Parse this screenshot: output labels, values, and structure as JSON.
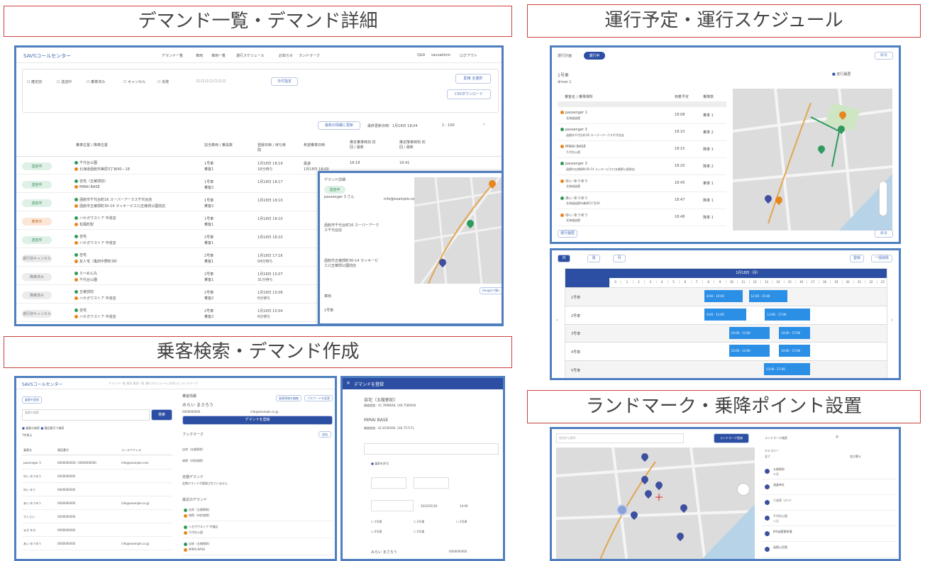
{
  "banners": {
    "demand_list": "デマンド一覧・デマンド詳細",
    "schedule": "運行予定・運行スケジュール",
    "passenger": "乗客検索・デマンド作成",
    "landmark": "ランドマーク・乗降ポイント設置"
  },
  "colors": {
    "panel_border": "#4f7fbf",
    "banner_border": "#c9433f",
    "accent": "#2b8fe6",
    "header_blue": "#2d4fa3"
  },
  "app": {
    "logo": "SAVSコールセンター",
    "nav": [
      "デマンド一覧",
      "車両",
      "車両一覧",
      "運行スケジュール",
      "お知らせ",
      "ランドマーク"
    ],
    "right": [
      "Q&A",
      "savsadmin",
      "ログアウト"
    ]
  },
  "demand_list": {
    "filters": [
      "確定前",
      "送迎中",
      "乗車済み",
      "キャンセル",
      "失敗"
    ],
    "date_button": "日付指定",
    "buttons": [
      "配車 全選択",
      "CSVダウンロード"
    ],
    "refresh": "最新の情報に更新",
    "updated": "最終更新日時：1月18日 18:04",
    "page": "1 - 100",
    "headers": [
      "乗車位置 / 降車位置",
      "割当車両 / 乗員数",
      "登録日時 / 待ち時間",
      "希望乗車日時",
      "推定乗車時刻 初回 / 最新",
      "推定降車時刻 初回 / 最新"
    ],
    "rows": [
      {
        "status": "送迎中",
        "kind": "green",
        "from": "千代台公園",
        "to": "北海道函館市美原3丁目40－18",
        "car": "1号車",
        "staff": "乗客1",
        "reg": "1月18日 18:19",
        "wait": "18分待ち",
        "want": "最速",
        "want2": "1月18日 18:00",
        "est1": "18:18",
        "est2": "18:41"
      },
      {
        "status": "送迎中",
        "kind": "green",
        "from": "自宅（五稜郭前）",
        "to": "MIRAI BASE",
        "car": "1号車",
        "staff": "乗客2",
        "reg": "1月18日 18:17"
      },
      {
        "status": "送迎中",
        "kind": "green",
        "from": "函館市千代台町16 スーパーアークス千代台店",
        "to": "函館市五稜郭町30-14 ラッキーピエロ五稜郭公園前店",
        "car": "1号車",
        "staff": "乗客2",
        "reg": "1月18日 18:10"
      },
      {
        "status": "乗車中",
        "kind": "orange",
        "from": "ハセガワストア 中道店",
        "to": "松風町駅",
        "car": "1号車",
        "staff": "乗客1",
        "reg": "1月18日 18:10"
      },
      {
        "status": "送迎中",
        "kind": "green",
        "from": "自宅",
        "to": "ハセガワストア 中道店",
        "car": "2号車",
        "staff": "乗客1",
        "reg": "1月18日 18:10"
      },
      {
        "status": "運行前キャンセル",
        "kind": "gray",
        "from": "自宅",
        "to": "友人宅（亀田中野町38）",
        "car": "2号車",
        "staff": "乗客1",
        "reg": "1月18日 17:16",
        "wait": "04分待ち"
      },
      {
        "status": "降車済み",
        "kind": "gray",
        "from": "ら～めん丸",
        "to": "千代台公園",
        "car": "2号車",
        "staff": "乗客1",
        "reg": "1月18日 15:07",
        "wait": "31分待ち"
      },
      {
        "status": "降車済み",
        "kind": "gray",
        "from": "五稜郭前",
        "to": "ハセガワストア 中道店",
        "car": "2号車",
        "staff": "乗客2",
        "reg": "1月18日 15:08",
        "wait": "6分待ち"
      },
      {
        "status": "運行前キャンセル",
        "kind": "gray",
        "from": "自宅",
        "to": "ハセガワストア 中道店",
        "car": "2号車",
        "staff": "乗客2",
        "reg": "1月18日 15:04",
        "wait": "6分待ち"
      }
    ],
    "popup": {
      "title": "デマンド詳細",
      "badge": "送迎中",
      "name": "passenger 3 さん",
      "email": "info@example.com",
      "stop1": "函館市千代台町16 スーパーアークス千代台店",
      "stop2": "函館市五稜郭町30-14 ラッキーピエロ五稜郭公園前店",
      "car_label": "車両",
      "car": "1号車",
      "btn": "Googleで開く"
    }
  },
  "schedule": {
    "title": "運行計画",
    "badge": "運行中",
    "back": "戻る",
    "car": "1号車",
    "driver": "driver 1",
    "show_route": "走行履歴",
    "headers": [
      "乗客名 / 乗降場所",
      "到着予定",
      "乗降数"
    ],
    "stops": [
      {
        "name": "passenger 1",
        "place": "北海道函館",
        "time": "18:08",
        "count": "乗車 1"
      },
      {
        "name": "passenger 3",
        "place": "函館市千代台町16 スーパーアークス千代台店",
        "time": "18:10",
        "count": "乗車 2"
      },
      {
        "name": "MIRAI BASE",
        "place": "千代台公園",
        "time": "18:15",
        "count": "降車 1"
      },
      {
        "name": "passenger 3",
        "place": "函館市五稜郭町30-14 ラッキーピエロ五稜郭公園前店",
        "time": "18:20",
        "count": "降車 2"
      },
      {
        "name": "ゆい ゆうゆう",
        "place": "北海道函館",
        "time": "18:45",
        "count": "乗車 1"
      },
      {
        "name": "あい ゆうゆう",
        "place": "北海道函館市美原3丁目40",
        "time": "18:47",
        "count": "降車 1"
      },
      {
        "name": "ゆい ゆうゆう",
        "place": "北海道函館",
        "time": "18:48",
        "count": "降車 1"
      }
    ],
    "bottom_left": "運行履歴",
    "bottom_right": "戻る",
    "gantt_tabs": [
      "日",
      "週",
      "月"
    ],
    "gantt_right": [
      "登録",
      "一括削除"
    ],
    "date": "1月18日（月）",
    "hours": [
      "0",
      "1",
      "2",
      "3",
      "4",
      "5",
      "6",
      "7",
      "8",
      "9",
      "10",
      "11",
      "12",
      "13",
      "14",
      "15",
      "16",
      "17",
      "18",
      "19",
      "20",
      "21",
      "22",
      "23"
    ],
    "cars": [
      "1号車",
      "2号車",
      "3号車",
      "4号車",
      "5号車"
    ],
    "bars": [
      {
        "car": 0,
        "start": 8.2,
        "end": 11.5,
        "label": "8:00 - 10:00"
      },
      {
        "car": 0,
        "start": 12.0,
        "end": 15.3,
        "label": "12:00 - 15:00"
      },
      {
        "car": 1,
        "start": 8.2,
        "end": 11.8,
        "label": "8:00 - 11:00"
      },
      {
        "car": 1,
        "start": 13.4,
        "end": 17.3,
        "label": "13:00 - 17:00"
      },
      {
        "car": 2,
        "start": 10.3,
        "end": 13.8,
        "label": "10:00 - 13:00"
      },
      {
        "car": 2,
        "start": 14.6,
        "end": 17.3,
        "label": "14:00 - 17:00"
      },
      {
        "car": 3,
        "start": 10.3,
        "end": 13.8,
        "label": "10:00 - 13:00"
      },
      {
        "car": 3,
        "start": 14.6,
        "end": 17.3,
        "label": "14:00 - 17:00"
      },
      {
        "car": 4,
        "start": 13.3,
        "end": 17.3,
        "label": "13:00 - 17:00"
      }
    ]
  },
  "passenger": {
    "new_btn": "乗客を登録",
    "search_label": "乗客を検索",
    "search_btn": "検索",
    "checks": [
      "乗客の検索",
      "電話番号で検索"
    ],
    "result": "7件表示",
    "headers": [
      "乗客名",
      "電話番号",
      "メールアドレス"
    ],
    "rows": [
      {
        "name": "passenger 3",
        "tel": "0000000000 / 0000000000",
        "mail": "info@example.com"
      },
      {
        "name": "ゆい ゆうゆう",
        "tel": "0000000000",
        "mail": ""
      },
      {
        "name": "ゆい ゆう",
        "tel": "0000000000",
        "mail": ""
      },
      {
        "name": "あい ゆうゆう",
        "tel": "0000000000",
        "mail": "info@example.co.jp"
      },
      {
        "name": "さくらい",
        "tel": "0000000000",
        "mail": ""
      },
      {
        "name": "まき ゆき",
        "tel": "0000000000",
        "mail": ""
      },
      {
        "name": "あい ゆうゆう",
        "tel": "0000000000",
        "mail": "info@example.co.jp"
      }
    ],
    "detail_title": "乗客情報",
    "detail_name": "みらい まさろう",
    "detail_tel": "0000000000",
    "detail_mail": "info@example.co.jp",
    "detail_btns": [
      "乗客情報を編集",
      "パスワードを変更"
    ],
    "create_btn": "デマンドを登録",
    "bookmark": "ブックマーク",
    "bm_edit": "追加",
    "bookmarks": [
      "自宅（五稜郭前）",
      "病院（市民病院）"
    ],
    "regular": "定期デマンド",
    "regular_none": "定期デマンドが登録されていません",
    "recent": "最近のデマンド",
    "recent_items": [
      {
        "from": "自宅（五稜郭前）",
        "to": "病院（市民病院）"
      },
      {
        "from": "ハセガワストア 中道店",
        "to": "千代台公園"
      },
      {
        "from": "自宅（五稜郭前）",
        "to": "MIRAI BASE"
      }
    ]
  },
  "create": {
    "title": "デマンドを登録",
    "from": "自宅（五稜郭前）",
    "from_pos": "緯度経度：41.7898648, 140.7580044",
    "to": "MIRAI BASE",
    "to_pos": "緯度経度：41.8149390, 140.757171",
    "check": "乗車を許可",
    "date": "2022/01/18",
    "time": "14:00",
    "cars": [
      "1号車",
      "2号車",
      "3号車",
      "4号車",
      "5号車"
    ],
    "passenger": "みらい まさろう",
    "tel": "0000000000"
  },
  "landmark": {
    "search_placeholder": "住所から探す",
    "btn1": "ランドマーク登録",
    "btn2": "ランドマーク検索",
    "category": "カテゴリー",
    "category_val": "全て",
    "sort": "並び替え",
    "items": [
      {
        "name": "五稜郭前",
        "sub": "市電"
      },
      {
        "name": "湯倉神社",
        "sub": ""
      },
      {
        "name": "六花亭（デリ）",
        "sub": ""
      },
      {
        "name": "千代台公園",
        "sub": "公園"
      },
      {
        "name": "JRA函館競馬場",
        "sub": ""
      },
      {
        "name": "函館公民館",
        "sub": ""
      }
    ]
  }
}
